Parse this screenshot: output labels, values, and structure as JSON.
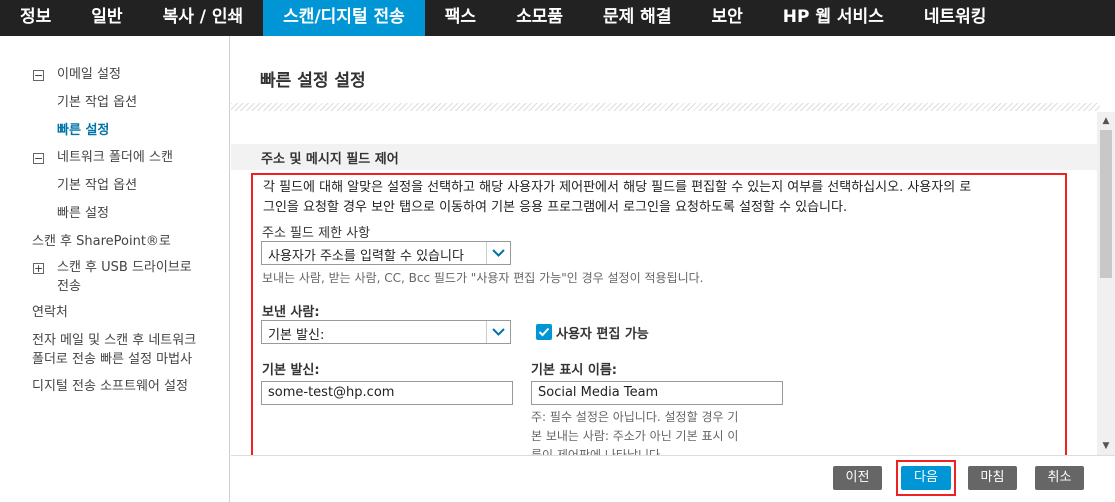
{
  "topnav": {
    "tabs": [
      "정보",
      "일반",
      "복사 / 인쇄",
      "스캔/디지털 전송",
      "팩스",
      "소모품",
      "문제 해결",
      "보안",
      "HP 웹 서비스",
      "네트워킹"
    ],
    "active_index": 3
  },
  "sidebar": {
    "email_settings": "이메일 설정",
    "email_default_options": "기본 작업 옵션",
    "email_quick_sets": "빠른 설정",
    "network_folder": "네트워크 폴더에 스캔",
    "folder_default_options": "기본 작업 옵션",
    "folder_quick_sets": "빠른 설정",
    "sharepoint": "스캔 후 SharePoint®로",
    "usb_line1": "스캔 후 USB 드라이브로",
    "usb_line2": "전송",
    "contacts": "연락처",
    "wizard_line1": "전자 메일 및 스캔 후 네트워크",
    "wizard_line2": "폴더로 전송 빠른 설정 마법사",
    "software": "디지털 전송 소프트웨어 설정"
  },
  "main": {
    "title": "빠른 설정 설정",
    "section_title": "주소 및 메시지 필드 제어",
    "description_line1": "각 필드에 대해 알맞은 설정을 선택하고 해당 사용자가 제어판에서 해당 필드를 편집할 수 있는지 여부를 선택하십시오. 사용자의 로",
    "description_line2": "그인을 요청할 경우 보안 탭으로 이동하여 기본 응용 프로그램에서 로그인을 요청하도록 설정할 수 있습니다.",
    "address_restriction_label": "주소 필드 제한 사항",
    "address_restriction_value": "사용자가 주소를 입력할 수 있습니다",
    "address_note": "보내는 사람, 받는 사람, CC, Bcc 필드가 \"사용자 편집 가능\"인 경우 설정이 적용됩니다.",
    "from_label": "보낸 사람:",
    "from_value": "기본 발신:",
    "user_editable_label": "사용자 편집 가능",
    "user_editable_checked": true,
    "default_from_label": "기본 발신:",
    "default_from_value": "some-test@hp.com",
    "display_name_label": "기본 표시 이름:",
    "display_name_value": "Social Media Team",
    "display_note_line1": "주: 필수 설정은 아닙니다. 설정할 경우 기",
    "display_note_line2": "본 보내는 사람: 주소가 아닌 기본 표시 이",
    "display_note_line3": "름이 제어판에 나타납니다."
  },
  "buttons": {
    "prev": "이전",
    "next": "다음",
    "finish": "마침",
    "cancel": "취소"
  },
  "colors": {
    "accent": "#0096d6",
    "nav_bg": "#222222",
    "highlight": "#ee2222"
  }
}
